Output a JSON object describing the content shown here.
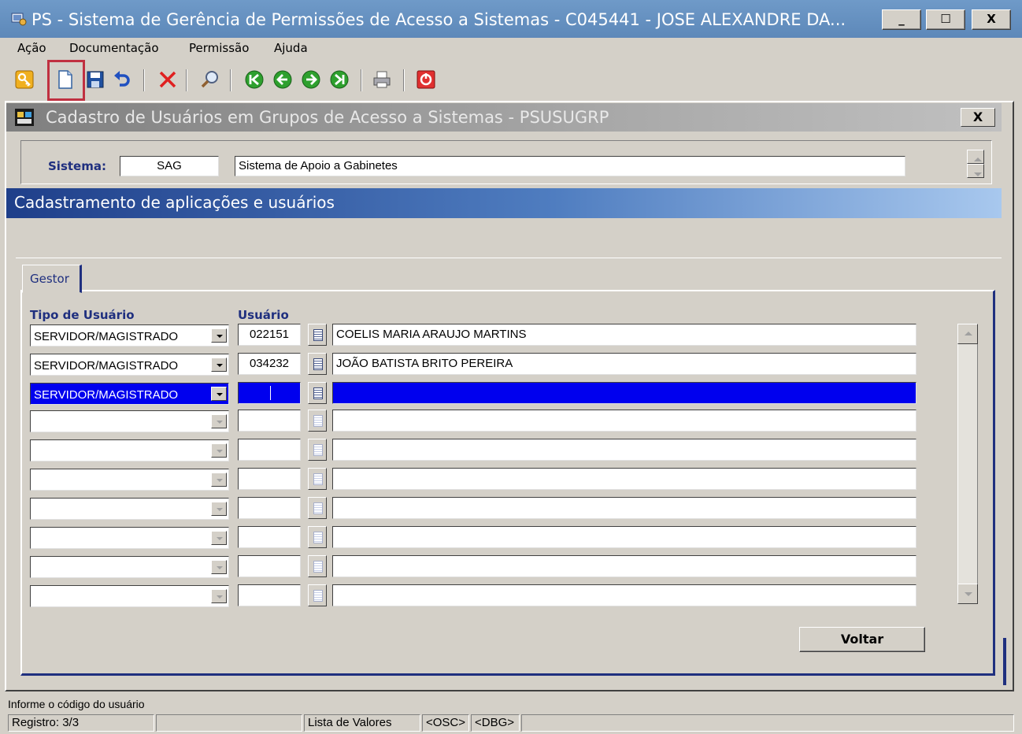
{
  "window": {
    "title": "PS - Sistema de Gerência de Permissões de Acesso a Sistemas    -   C045441 - JOSE ALEXANDRE DA...",
    "minimize": "_",
    "maximize": "☐",
    "close": "X"
  },
  "menu": {
    "items": [
      {
        "label": "Ação"
      },
      {
        "label": "Documentação"
      },
      {
        "label": "Permissão"
      },
      {
        "label": "Ajuda"
      }
    ]
  },
  "toolbar": {
    "icons": [
      "key-icon",
      "new-document-icon",
      "save-icon",
      "undo-icon",
      "delete-icon",
      "search-icon",
      "first-record-icon",
      "previous-record-icon",
      "next-record-icon",
      "last-record-icon",
      "print-icon",
      "exit-icon"
    ]
  },
  "child": {
    "title": "Cadastro de Usuários em Grupos de Acesso a Sistemas - PSUSUGRP",
    "close": "X"
  },
  "sistema": {
    "label": "Sistema:",
    "code": "SAG",
    "name": "Sistema de Apoio a Gabinetes"
  },
  "section": {
    "title": "Cadastramento de aplicações e usuários"
  },
  "tabs": [
    {
      "label": "Gestor"
    }
  ],
  "grid": {
    "col_tipo": "Tipo de Usuário",
    "col_usuario": "Usuário",
    "rows": [
      {
        "tipo": "SERVIDOR/MAGISTRADO",
        "codigo": "022151",
        "nome": "COELIS MARIA ARAUJO MARTINS"
      },
      {
        "tipo": "SERVIDOR/MAGISTRADO",
        "codigo": "034232",
        "nome": "JOÃO BATISTA BRITO PEREIRA"
      },
      {
        "tipo": "SERVIDOR/MAGISTRADO",
        "codigo": "",
        "nome": ""
      },
      {
        "tipo": "",
        "codigo": "",
        "nome": ""
      },
      {
        "tipo": "",
        "codigo": "",
        "nome": ""
      },
      {
        "tipo": "",
        "codigo": "",
        "nome": ""
      },
      {
        "tipo": "",
        "codigo": "",
        "nome": ""
      },
      {
        "tipo": "",
        "codigo": "",
        "nome": ""
      },
      {
        "tipo": "",
        "codigo": "",
        "nome": ""
      },
      {
        "tipo": "",
        "codigo": "",
        "nome": ""
      }
    ]
  },
  "buttons": {
    "voltar": "Voltar"
  },
  "status": {
    "message": "Informe o código do usuário",
    "registro": "Registro: 3/3",
    "lista": "Lista de Valores",
    "osc": "<OSC>",
    "dbg": "<DBG>"
  }
}
